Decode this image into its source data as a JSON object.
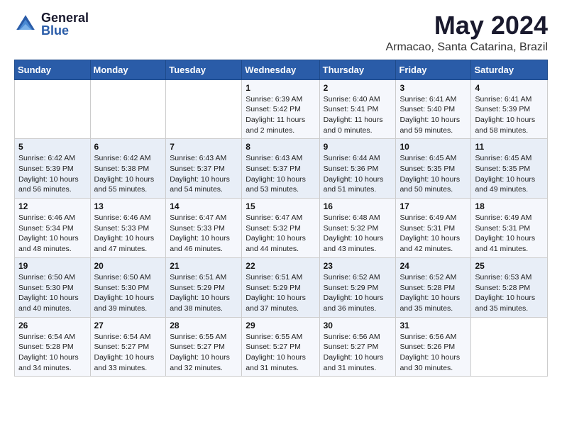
{
  "header": {
    "logo_general": "General",
    "logo_blue": "Blue",
    "title": "May 2024",
    "subtitle": "Armacao, Santa Catarina, Brazil"
  },
  "days_of_week": [
    "Sunday",
    "Monday",
    "Tuesday",
    "Wednesday",
    "Thursday",
    "Friday",
    "Saturday"
  ],
  "weeks": [
    [
      {
        "day": "",
        "info": ""
      },
      {
        "day": "",
        "info": ""
      },
      {
        "day": "",
        "info": ""
      },
      {
        "day": "1",
        "info": "Sunrise: 6:39 AM\nSunset: 5:42 PM\nDaylight: 11 hours\nand 2 minutes."
      },
      {
        "day": "2",
        "info": "Sunrise: 6:40 AM\nSunset: 5:41 PM\nDaylight: 11 hours\nand 0 minutes."
      },
      {
        "day": "3",
        "info": "Sunrise: 6:41 AM\nSunset: 5:40 PM\nDaylight: 10 hours\nand 59 minutes."
      },
      {
        "day": "4",
        "info": "Sunrise: 6:41 AM\nSunset: 5:39 PM\nDaylight: 10 hours\nand 58 minutes."
      }
    ],
    [
      {
        "day": "5",
        "info": "Sunrise: 6:42 AM\nSunset: 5:39 PM\nDaylight: 10 hours\nand 56 minutes."
      },
      {
        "day": "6",
        "info": "Sunrise: 6:42 AM\nSunset: 5:38 PM\nDaylight: 10 hours\nand 55 minutes."
      },
      {
        "day": "7",
        "info": "Sunrise: 6:43 AM\nSunset: 5:37 PM\nDaylight: 10 hours\nand 54 minutes."
      },
      {
        "day": "8",
        "info": "Sunrise: 6:43 AM\nSunset: 5:37 PM\nDaylight: 10 hours\nand 53 minutes."
      },
      {
        "day": "9",
        "info": "Sunrise: 6:44 AM\nSunset: 5:36 PM\nDaylight: 10 hours\nand 51 minutes."
      },
      {
        "day": "10",
        "info": "Sunrise: 6:45 AM\nSunset: 5:35 PM\nDaylight: 10 hours\nand 50 minutes."
      },
      {
        "day": "11",
        "info": "Sunrise: 6:45 AM\nSunset: 5:35 PM\nDaylight: 10 hours\nand 49 minutes."
      }
    ],
    [
      {
        "day": "12",
        "info": "Sunrise: 6:46 AM\nSunset: 5:34 PM\nDaylight: 10 hours\nand 48 minutes."
      },
      {
        "day": "13",
        "info": "Sunrise: 6:46 AM\nSunset: 5:33 PM\nDaylight: 10 hours\nand 47 minutes."
      },
      {
        "day": "14",
        "info": "Sunrise: 6:47 AM\nSunset: 5:33 PM\nDaylight: 10 hours\nand 46 minutes."
      },
      {
        "day": "15",
        "info": "Sunrise: 6:47 AM\nSunset: 5:32 PM\nDaylight: 10 hours\nand 44 minutes."
      },
      {
        "day": "16",
        "info": "Sunrise: 6:48 AM\nSunset: 5:32 PM\nDaylight: 10 hours\nand 43 minutes."
      },
      {
        "day": "17",
        "info": "Sunrise: 6:49 AM\nSunset: 5:31 PM\nDaylight: 10 hours\nand 42 minutes."
      },
      {
        "day": "18",
        "info": "Sunrise: 6:49 AM\nSunset: 5:31 PM\nDaylight: 10 hours\nand 41 minutes."
      }
    ],
    [
      {
        "day": "19",
        "info": "Sunrise: 6:50 AM\nSunset: 5:30 PM\nDaylight: 10 hours\nand 40 minutes."
      },
      {
        "day": "20",
        "info": "Sunrise: 6:50 AM\nSunset: 5:30 PM\nDaylight: 10 hours\nand 39 minutes."
      },
      {
        "day": "21",
        "info": "Sunrise: 6:51 AM\nSunset: 5:29 PM\nDaylight: 10 hours\nand 38 minutes."
      },
      {
        "day": "22",
        "info": "Sunrise: 6:51 AM\nSunset: 5:29 PM\nDaylight: 10 hours\nand 37 minutes."
      },
      {
        "day": "23",
        "info": "Sunrise: 6:52 AM\nSunset: 5:29 PM\nDaylight: 10 hours\nand 36 minutes."
      },
      {
        "day": "24",
        "info": "Sunrise: 6:52 AM\nSunset: 5:28 PM\nDaylight: 10 hours\nand 35 minutes."
      },
      {
        "day": "25",
        "info": "Sunrise: 6:53 AM\nSunset: 5:28 PM\nDaylight: 10 hours\nand 35 minutes."
      }
    ],
    [
      {
        "day": "26",
        "info": "Sunrise: 6:54 AM\nSunset: 5:28 PM\nDaylight: 10 hours\nand 34 minutes."
      },
      {
        "day": "27",
        "info": "Sunrise: 6:54 AM\nSunset: 5:27 PM\nDaylight: 10 hours\nand 33 minutes."
      },
      {
        "day": "28",
        "info": "Sunrise: 6:55 AM\nSunset: 5:27 PM\nDaylight: 10 hours\nand 32 minutes."
      },
      {
        "day": "29",
        "info": "Sunrise: 6:55 AM\nSunset: 5:27 PM\nDaylight: 10 hours\nand 31 minutes."
      },
      {
        "day": "30",
        "info": "Sunrise: 6:56 AM\nSunset: 5:27 PM\nDaylight: 10 hours\nand 31 minutes."
      },
      {
        "day": "31",
        "info": "Sunrise: 6:56 AM\nSunset: 5:26 PM\nDaylight: 10 hours\nand 30 minutes."
      },
      {
        "day": "",
        "info": ""
      }
    ]
  ]
}
